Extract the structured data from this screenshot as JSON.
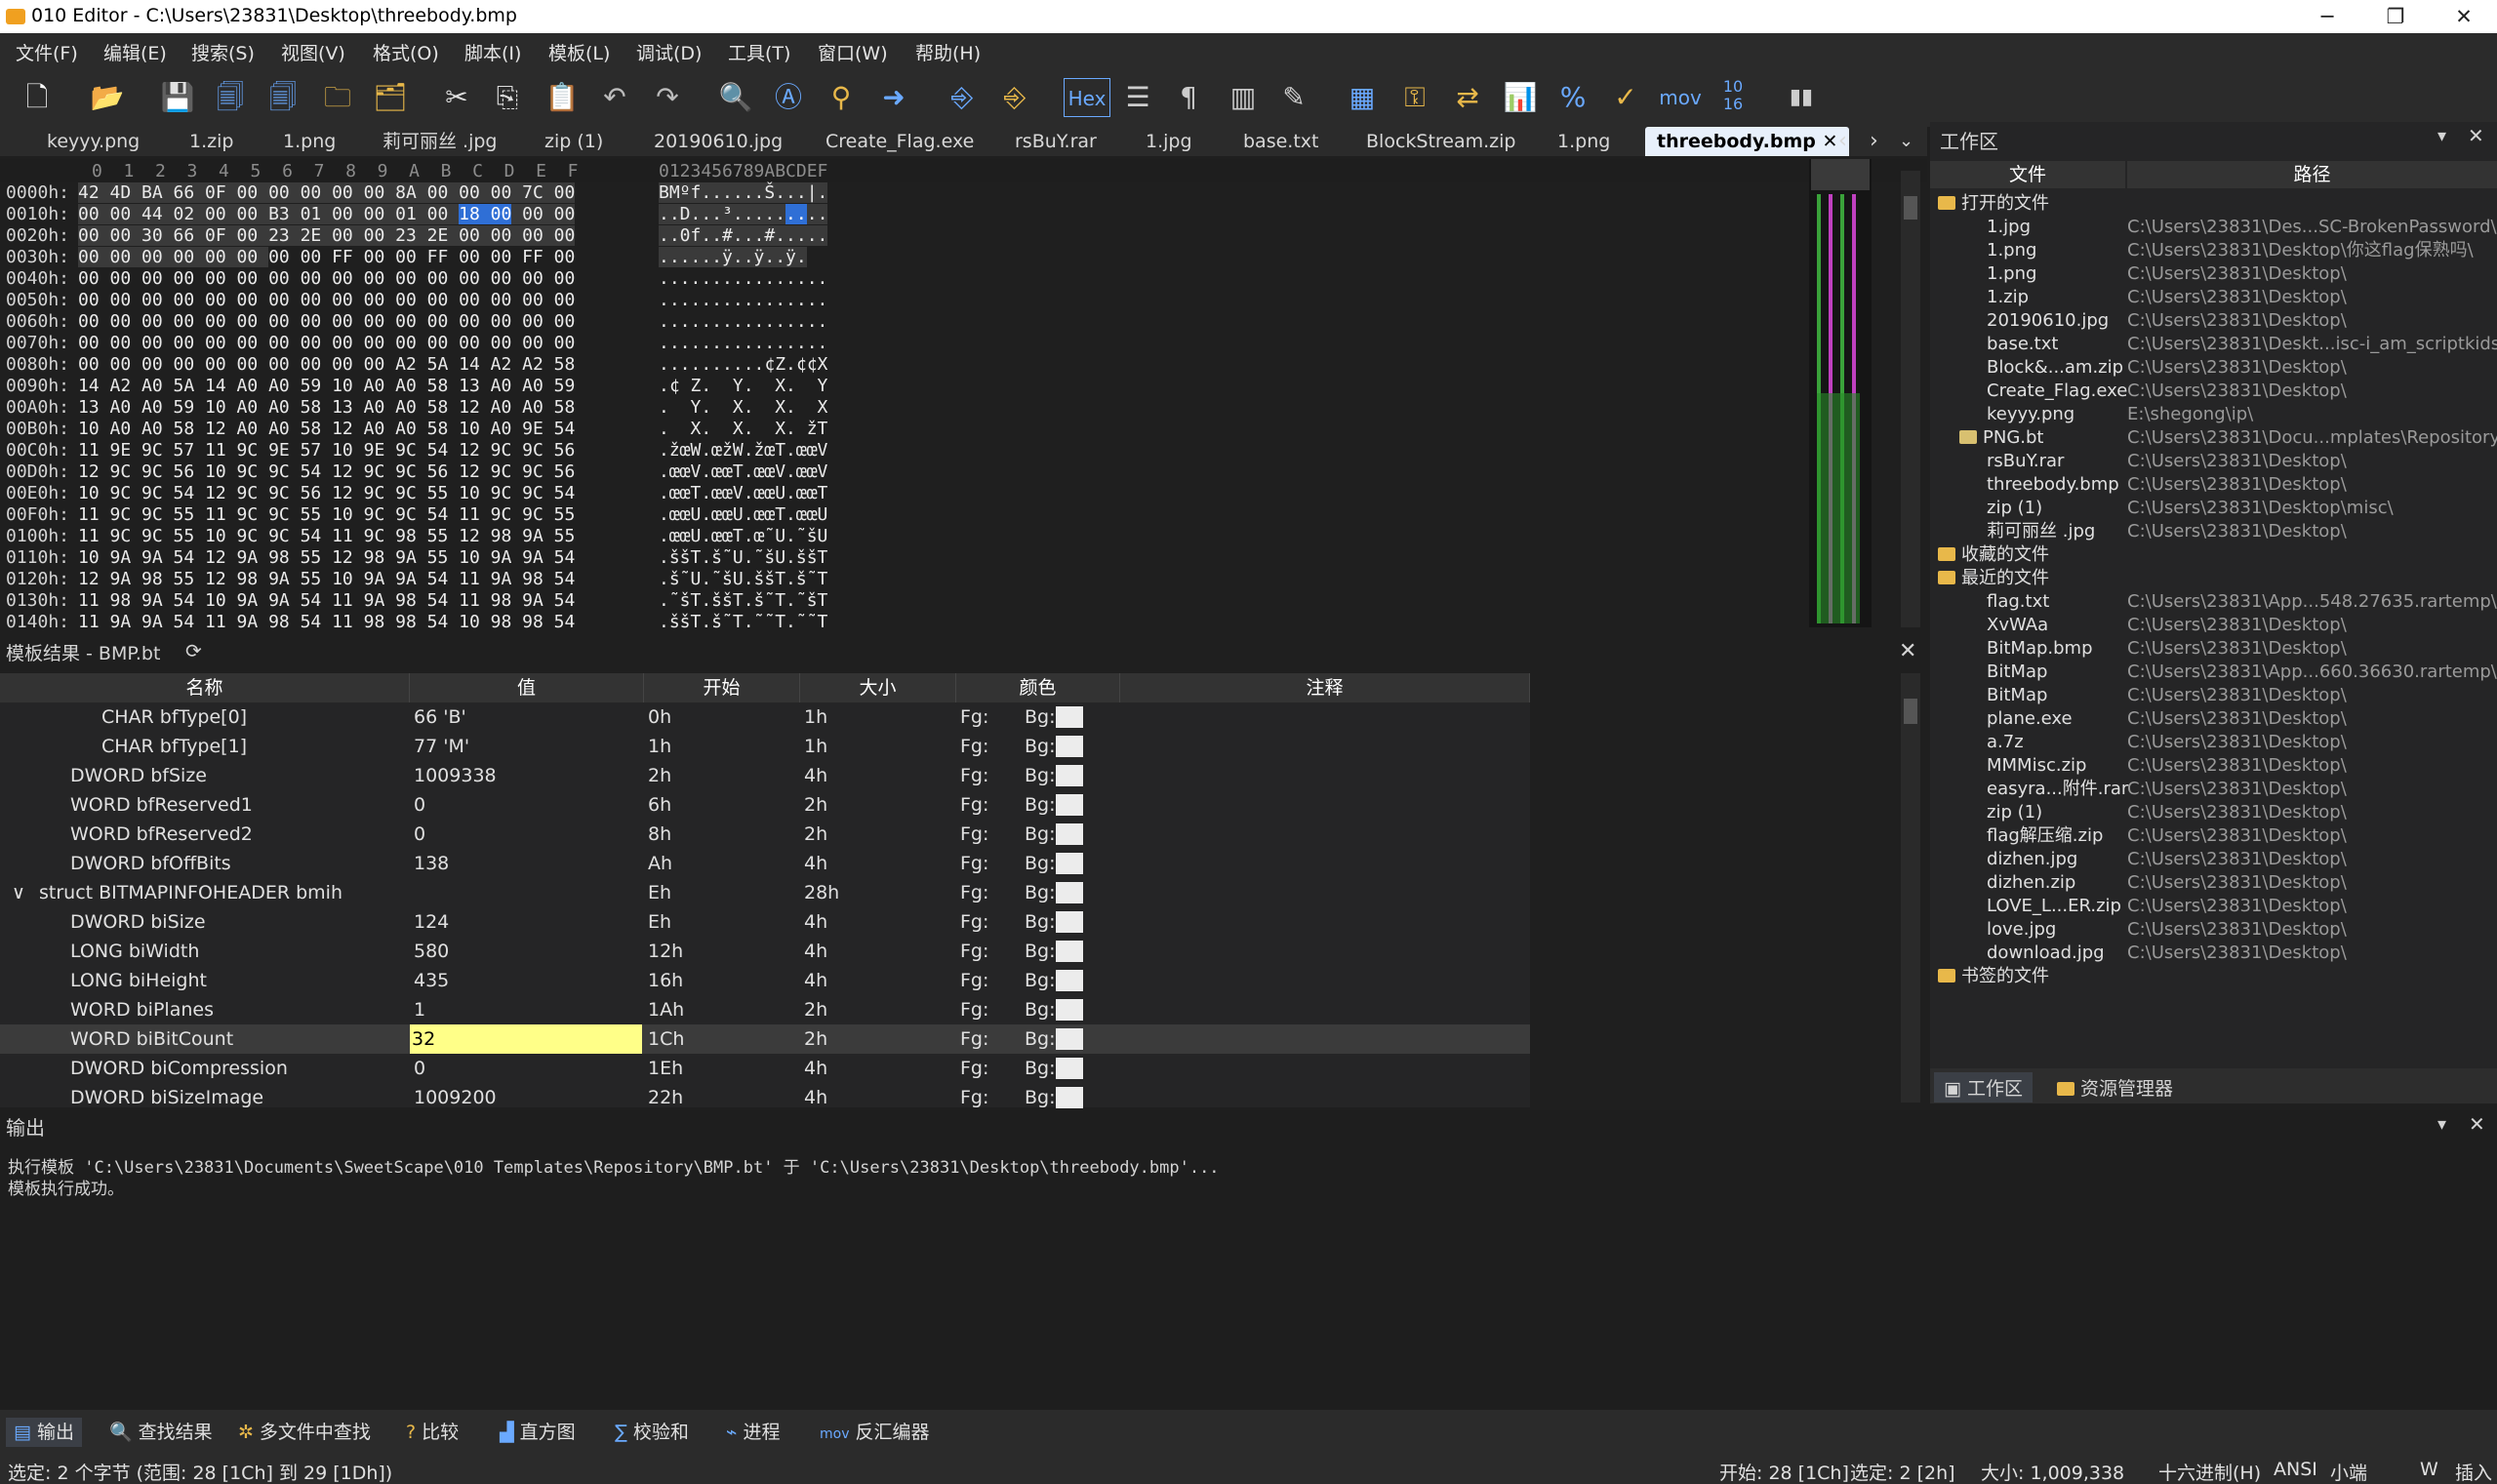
{
  "window": {
    "title": "010 Editor - C:\\Users\\23831\\Desktop\\threebody.bmp",
    "min": "─",
    "max": "❐",
    "close": "✕"
  },
  "menu": [
    "文件(F)",
    "编辑(E)",
    "搜索(S)",
    "视图(V)",
    "格式(O)",
    "脚本(I)",
    "模板(L)",
    "调试(D)",
    "工具(T)",
    "窗口(W)",
    "帮助(H)"
  ],
  "toolbar": {
    "hex_label": "Hex",
    "mov_label": "mov",
    "base_label": "10\n16"
  },
  "tabs": [
    "keyyy.png",
    "1.zip",
    "1.png",
    "莉可丽丝 .jpg",
    "zip (1)",
    "20190610.jpg",
    "Create_Flag.exe",
    "rsBuY.rar",
    "1.jpg",
    "base.txt",
    "BlockStream.zip",
    "1.png",
    "threebody.bmp"
  ],
  "hex": {
    "col_header": "0  1  2  3  4  5  6  7  8  9  A  B  C  D  E  F",
    "ascii_header": "0123456789ABCDEF",
    "rows": [
      {
        "addr": "0000h:",
        "b1": "42 4D BA 66 0F 00 00 00 ",
        "b2": "00 00 8A 00 00 00 7C 00",
        "asc": "BMºf......Š...|."
      },
      {
        "addr": "0010h:",
        "b1": "00 00 44 02 00 00 B3 01 ",
        "b2": "00 00 01 00 ",
        "sel": "18 00",
        "b3": " 00 00",
        "asc1": "..D...³.....",
        "ascsel": "..",
        "asc2": ".."
      },
      {
        "addr": "0020h:",
        "b1": "00 00 30 66 0F 00 23 2E ",
        "b2": "00 00 23 2E 00 00 00 00",
        "asc": "..0f..#...#....."
      },
      {
        "addr": "0030h:",
        "b1": "00 00 00 00 00 00 ",
        "b2": "00 00 FF 00 00 FF 00 00 FF 00",
        "asc": "......ÿ..ÿ..ÿ."
      },
      {
        "addr": "0040h:",
        "b1": "00 00 00 00 00 00 00 00 ",
        "b2": "00 00 00 00 00 00 00 00",
        "asc": "................"
      },
      {
        "addr": "0050h:",
        "b1": "00 00 00 00 00 00 00 00 ",
        "b2": "00 00 00 00 00 00 00 00",
        "asc": "................"
      },
      {
        "addr": "0060h:",
        "b1": "00 00 00 00 00 00 00 00 ",
        "b2": "00 00 00 00 00 00 00 00",
        "asc": "................"
      },
      {
        "addr": "0070h:",
        "b1": "00 00 00 00 00 00 00 00 ",
        "b2": "00 00 00 00 00 00 00 00",
        "asc": "................"
      },
      {
        "addr": "0080h:",
        "b1": "00 00 00 00 00 00 00 00 ",
        "b2": "00 00 A2 5A 14 A2 A2 58",
        "asc": "..........¢Z.¢¢X"
      },
      {
        "addr": "0090h:",
        "b1": "14 A2 A0 5A 14 A0 A0 59 ",
        "b2": "10 A0 A0 58 13 A0 A0 59",
        "asc": ".¢ Z.  Y.  X.  Y"
      },
      {
        "addr": "00A0h:",
        "b1": "13 A0 A0 59 10 A0 A0 58 ",
        "b2": "13 A0 A0 58 12 A0 A0 58",
        "asc": ".  Y.  X.  X.  X"
      },
      {
        "addr": "00B0h:",
        "b1": "10 A0 A0 58 12 A0 A0 58 ",
        "b2": "12 A0 A0 58 10 A0 9E 54",
        "asc": ".  X.  X.  X. žT"
      },
      {
        "addr": "00C0h:",
        "b1": "11 9E 9C 57 11 9C 9E 57 ",
        "b2": "10 9E 9C 54 12 9C 9C 56",
        "asc": ".žœW.œžW.žœT.œœV"
      },
      {
        "addr": "00D0h:",
        "b1": "12 9C 9C 56 10 9C 9C 54 ",
        "b2": "12 9C 9C 56 12 9C 9C 56",
        "asc": ".œœV.œœT.œœV.œœV"
      },
      {
        "addr": "00E0h:",
        "b1": "10 9C 9C 54 12 9C 9C 56 ",
        "b2": "12 9C 9C 55 10 9C 9C 54",
        "asc": ".œœT.œœV.œœU.œœT"
      },
      {
        "addr": "00F0h:",
        "b1": "11 9C 9C 55 11 9C 9C 55 ",
        "b2": "10 9C 9C 54 11 9C 9C 55",
        "asc": ".œœU.œœU.œœT.œœU"
      },
      {
        "addr": "0100h:",
        "b1": "11 9C 9C 55 10 9C 9C 54 ",
        "b2": "11 9C 98 55 12 98 9A 55",
        "asc": ".œœU.œœT.œ˜U.˜šU"
      },
      {
        "addr": "0110h:",
        "b1": "10 9A 9A 54 12 9A 98 55 ",
        "b2": "12 98 9A 55 10 9A 9A 54",
        "asc": ".ššT.š˜U.˜šU.ššT"
      },
      {
        "addr": "0120h:",
        "b1": "12 9A 98 55 12 98 9A 55 ",
        "b2": "10 9A 9A 54 11 9A 98 54",
        "asc": ".š˜U.˜šU.ššT.š˜T"
      },
      {
        "addr": "0130h:",
        "b1": "11 98 9A 54 10 9A 9A 54 ",
        "b2": "11 9A 98 54 11 98 9A 54",
        "asc": ".˜šT.ššT.š˜T.˜šT"
      },
      {
        "addr": "0140h:",
        "b1": "11 9A 9A 54 11 9A 98 54 ",
        "b2": "11 98 98 54 10 98 98 54",
        "asc": ".ššT.š˜T.˜˜T.˜˜T"
      }
    ]
  },
  "template": {
    "title": "模板结果 - BMP.bt",
    "headers": [
      "名称",
      "值",
      "开始",
      "大小",
      "颜色",
      "注释"
    ],
    "fg": "Fg:",
    "bg": "Bg:",
    "rows": [
      {
        "name": "CHAR bfType[0]",
        "value": "66 'B'",
        "start": "0h",
        "size": "1h",
        "indent": 3
      },
      {
        "name": "CHAR bfType[1]",
        "value": "77 'M'",
        "start": "1h",
        "size": "1h",
        "indent": 3
      },
      {
        "name": "DWORD bfSize",
        "value": "1009338",
        "start": "2h",
        "size": "4h",
        "indent": 2
      },
      {
        "name": "WORD bfReserved1",
        "value": "0",
        "start": "6h",
        "size": "2h",
        "indent": 2
      },
      {
        "name": "WORD bfReserved2",
        "value": "0",
        "start": "8h",
        "size": "2h",
        "indent": 2
      },
      {
        "name": "DWORD bfOffBits",
        "value": "138",
        "start": "Ah",
        "size": "4h",
        "indent": 2
      },
      {
        "name": "struct BITMAPINFOHEADER bmih",
        "value": "",
        "start": "Eh",
        "size": "28h",
        "indent": 1,
        "expander": "∨"
      },
      {
        "name": "DWORD biSize",
        "value": "124",
        "start": "Eh",
        "size": "4h",
        "indent": 2
      },
      {
        "name": "LONG biWidth",
        "value": "580",
        "start": "12h",
        "size": "4h",
        "indent": 2
      },
      {
        "name": "LONG biHeight",
        "value": "435",
        "start": "16h",
        "size": "4h",
        "indent": 2
      },
      {
        "name": "WORD biPlanes",
        "value": "1",
        "start": "1Ah",
        "size": "2h",
        "indent": 2
      },
      {
        "name": "WORD biBitCount",
        "value": "32",
        "start": "1Ch",
        "size": "2h",
        "indent": 2,
        "current": true
      },
      {
        "name": "DWORD biCompression",
        "value": "0",
        "start": "1Eh",
        "size": "4h",
        "indent": 2
      },
      {
        "name": "DWORD biSizeImage",
        "value": "1009200",
        "start": "22h",
        "size": "4h",
        "indent": 2
      }
    ]
  },
  "workspace": {
    "title": "工作区",
    "headers": [
      "文件",
      "路径"
    ],
    "open_group": "打开的文件",
    "open_files": [
      {
        "name": "1.jpg",
        "path": "C:\\Users\\23831\\Des...SC-BrokenPassword\\"
      },
      {
        "name": "1.png",
        "path": "C:\\Users\\23831\\Desktop\\你这flag保熟吗\\"
      },
      {
        "name": "1.png",
        "path": "C:\\Users\\23831\\Desktop\\"
      },
      {
        "name": "1.zip",
        "path": "C:\\Users\\23831\\Desktop\\"
      },
      {
        "name": "20190610.jpg",
        "path": "C:\\Users\\23831\\Desktop\\"
      },
      {
        "name": "base.txt",
        "path": "C:\\Users\\23831\\Deskt...isc-i_am_scriptkids\\"
      },
      {
        "name": "Block&...am.zip",
        "path": "C:\\Users\\23831\\Desktop\\"
      },
      {
        "name": "Create_Flag.exe",
        "path": "C:\\Users\\23831\\Desktop\\"
      },
      {
        "name": "keyyy.png",
        "path": "E:\\shegong\\ip\\"
      },
      {
        "name": "PNG.bt",
        "path": "C:\\Users\\23831\\Docu...mplates\\Repository\\",
        "sub": true
      },
      {
        "name": "rsBuY.rar",
        "path": "C:\\Users\\23831\\Desktop\\"
      },
      {
        "name": "threebody.bmp",
        "path": "C:\\Users\\23831\\Desktop\\"
      },
      {
        "name": "zip (1)",
        "path": "C:\\Users\\23831\\Desktop\\misc\\"
      },
      {
        "name": "莉可丽丝 .jpg",
        "path": "C:\\Users\\23831\\Desktop\\"
      }
    ],
    "fav_group": "收藏的文件",
    "recent_group": "最近的文件",
    "recent_files": [
      {
        "name": "flag.txt",
        "path": "C:\\Users\\23831\\App...548.27635.rartemp\\"
      },
      {
        "name": "XvWAa",
        "path": "C:\\Users\\23831\\Desktop\\"
      },
      {
        "name": "BitMap.bmp",
        "path": "C:\\Users\\23831\\Desktop\\"
      },
      {
        "name": "BitMap",
        "path": "C:\\Users\\23831\\App...660.36630.rartemp\\"
      },
      {
        "name": "BitMap",
        "path": "C:\\Users\\23831\\Desktop\\"
      },
      {
        "name": "plane.exe",
        "path": "C:\\Users\\23831\\Desktop\\"
      },
      {
        "name": "a.7z",
        "path": "C:\\Users\\23831\\Desktop\\"
      },
      {
        "name": "MMMisc.zip",
        "path": "C:\\Users\\23831\\Desktop\\"
      },
      {
        "name": "easyra...附件.rar",
        "path": "C:\\Users\\23831\\Desktop\\"
      },
      {
        "name": "zip (1)",
        "path": "C:\\Users\\23831\\Desktop\\"
      },
      {
        "name": "flag解压缩.zip",
        "path": "C:\\Users\\23831\\Desktop\\"
      },
      {
        "name": "dizhen.jpg",
        "path": "C:\\Users\\23831\\Desktop\\"
      },
      {
        "name": "dizhen.zip",
        "path": "C:\\Users\\23831\\Desktop\\"
      },
      {
        "name": "LOVE_L...ER.zip",
        "path": "C:\\Users\\23831\\Desktop\\"
      },
      {
        "name": "love.jpg",
        "path": "C:\\Users\\23831\\Desktop\\"
      },
      {
        "name": "download.jpg",
        "path": "C:\\Users\\23831\\Desktop\\"
      }
    ],
    "bookmark_group": "书签的文件",
    "tab_workspace": "工作区",
    "tab_explorer": "资源管理器"
  },
  "output": {
    "title": "输出",
    "lines": [
      "执行模板 'C:\\Users\\23831\\Documents\\SweetScape\\010 Templates\\Repository\\BMP.bt' 于 'C:\\Users\\23831\\Desktop\\threebody.bmp'...",
      "模板执行成功。"
    ]
  },
  "bottom_tabs": [
    "输出",
    "查找结果",
    "多文件中查找",
    "比较",
    "直方图",
    "校验和",
    "进程",
    "反汇编器"
  ],
  "status": {
    "selection": "选定: 2 个字节 (范围: 28 [1Ch] 到 29 [1Dh])",
    "start": "开始: 28 [1Ch]",
    "sel": "选定: 2 [2h]",
    "size": "大小: 1,009,338",
    "mode": "十六进制(H)",
    "encoding": "ANSI",
    "endian": "小端",
    "w": "W",
    "insert": "插入"
  },
  "colors": {
    "accent": "#2f6fd6",
    "edit_bg": "#ffff88",
    "tab_active": "#e8f0fb"
  }
}
